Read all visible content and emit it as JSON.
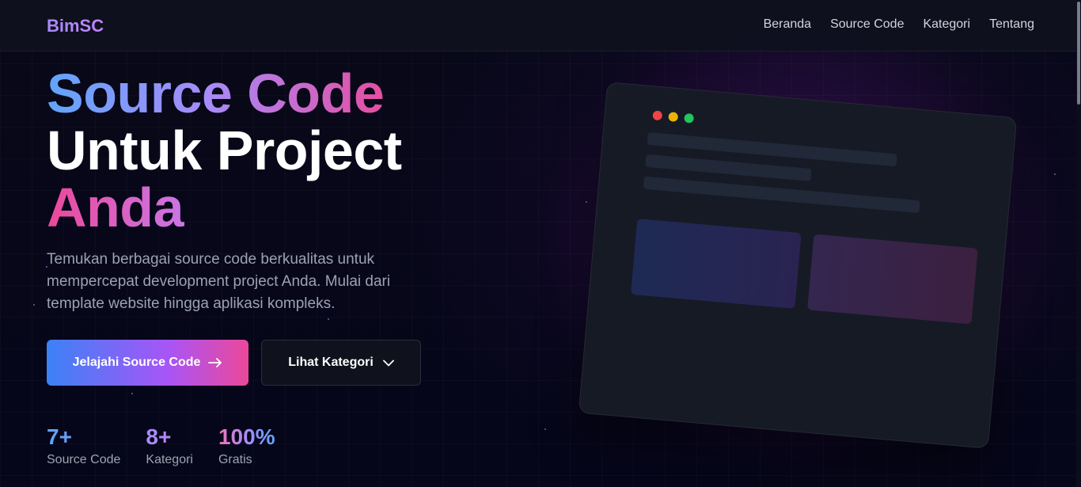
{
  "brand": {
    "logo": "BimSC"
  },
  "nav": {
    "items": [
      {
        "label": "Beranda"
      },
      {
        "label": "Source Code"
      },
      {
        "label": "Kategori"
      },
      {
        "label": "Tentang"
      }
    ]
  },
  "hero": {
    "headline": {
      "line1": "Source Code",
      "line2": "Untuk Project",
      "line3": "Anda"
    },
    "subtitle": "Temukan berbagai source code berkualitas untuk mempercepat development project Anda. Mulai dari template website hingga aplikasi kompleks.",
    "primary_button": {
      "label": "Jelajahi Source Code",
      "icon": "arrow-right-icon"
    },
    "secondary_button": {
      "label": "Lihat Kategori",
      "icon": "chevron-down-icon"
    }
  },
  "stats": [
    {
      "value": "7+",
      "label": "Source Code"
    },
    {
      "value": "8+",
      "label": "Kategori"
    },
    {
      "value": "100%",
      "label": "Gratis"
    }
  ],
  "mockup": {
    "window_dots": [
      "#ef4444",
      "#eab308",
      "#22c55e"
    ]
  },
  "colors": {
    "accent_blue": "#3b82f6",
    "accent_purple": "#a855f7",
    "accent_pink": "#ec4899",
    "background": "#070716"
  }
}
